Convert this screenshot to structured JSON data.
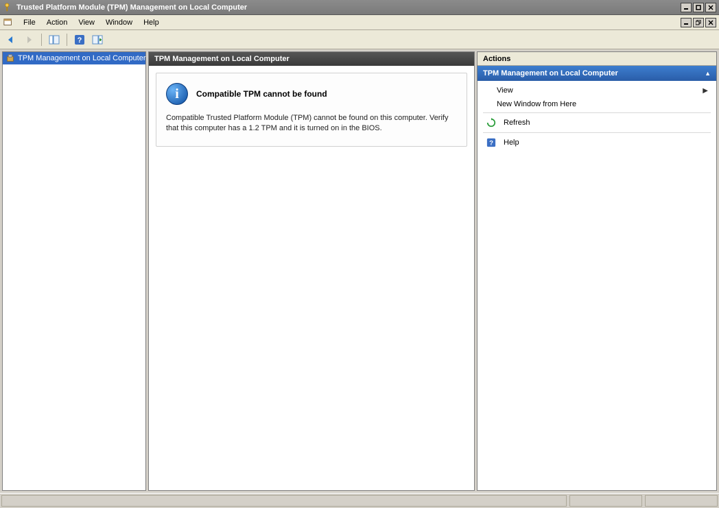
{
  "window": {
    "title": "Trusted Platform Module (TPM) Management on Local Computer"
  },
  "menu": {
    "file": "File",
    "action": "Action",
    "view": "View",
    "window": "Window",
    "help": "Help"
  },
  "tree": {
    "root": "TPM Management on Local Computer"
  },
  "center": {
    "header": "TPM Management on Local Computer",
    "message_title": "Compatible TPM cannot be found",
    "message_body": "Compatible Trusted Platform Module (TPM) cannot be found on this computer. Verify that this computer has a 1.2 TPM and it is turned on in the BIOS."
  },
  "actions": {
    "header": "Actions",
    "subheader": "TPM Management on Local Computer",
    "view": "View",
    "new_window": "New Window from Here",
    "refresh": "Refresh",
    "help": "Help"
  }
}
